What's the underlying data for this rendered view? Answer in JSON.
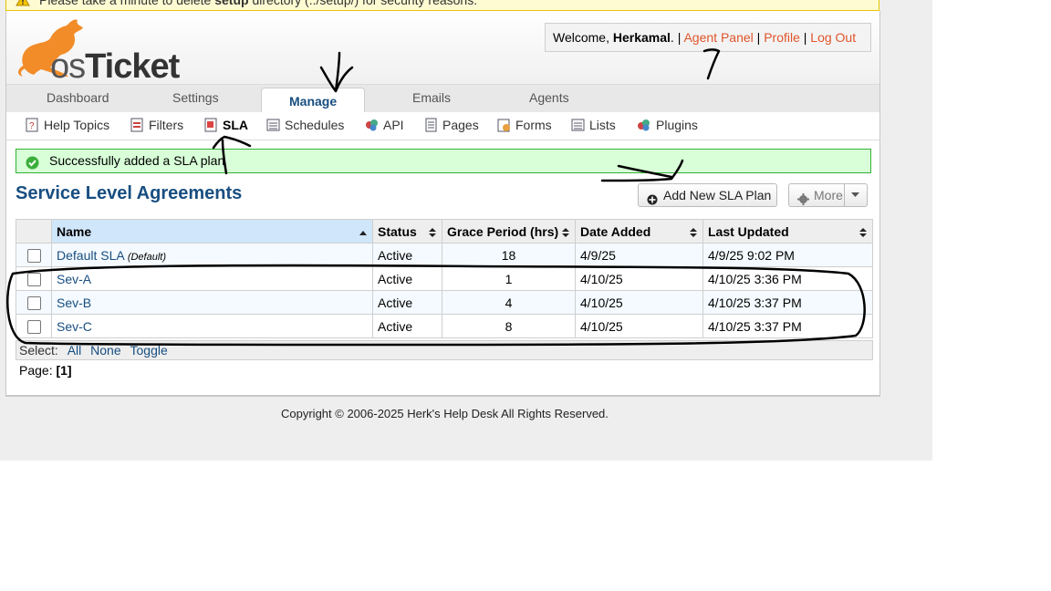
{
  "warning": {
    "prefix": "Please take a minute to delete",
    "bold": "setup",
    "suffix": "directory (../setup/) for security reasons."
  },
  "logo": {
    "text_os": "os",
    "text_ticket": "Ticket"
  },
  "userbox": {
    "welcome": "Welcome,",
    "username": "Herkamal",
    "agent_panel": "Agent Panel",
    "profile": "Profile",
    "logout": "Log Out",
    "sep": "|"
  },
  "tabs": [
    "Dashboard",
    "Settings",
    "Manage",
    "Emails",
    "Agents"
  ],
  "subnav": [
    "Help Topics",
    "Filters",
    "SLA",
    "Schedules",
    "API",
    "Pages",
    "Forms",
    "Lists",
    "Plugins"
  ],
  "success_message": "Successfully added a SLA plan",
  "page_title": "Service Level Agreements",
  "buttons": {
    "add": "Add New SLA Plan",
    "more": "More"
  },
  "table": {
    "headers": [
      "Name",
      "Status",
      "Grace Period (hrs)",
      "Date Added",
      "Last Updated"
    ],
    "rows": [
      {
        "name": "Default SLA",
        "tag": "(Default)",
        "status": "Active",
        "grace": "18",
        "added": "4/9/25",
        "updated": "4/9/25 9:02 PM"
      },
      {
        "name": "Sev-A",
        "tag": "",
        "status": "Active",
        "grace": "1",
        "added": "4/10/25",
        "updated": "4/10/25 3:36 PM"
      },
      {
        "name": "Sev-B",
        "tag": "",
        "status": "Active",
        "grace": "4",
        "added": "4/10/25",
        "updated": "4/10/25 3:37 PM"
      },
      {
        "name": "Sev-C",
        "tag": "",
        "status": "Active",
        "grace": "8",
        "added": "4/10/25",
        "updated": "4/10/25 3:37 PM"
      }
    ]
  },
  "select": {
    "label": "Select:",
    "all": "All",
    "none": "None",
    "toggle": "Toggle"
  },
  "pager": {
    "label": "Page:",
    "current": "[1]"
  },
  "footer": "Copyright © 2006-2025 Herk's Help Desk All Rights Reserved.",
  "colors": {
    "accent_blue": "#184e81",
    "link_orange": "#e0552b",
    "success_green": "#d8ffd8"
  }
}
